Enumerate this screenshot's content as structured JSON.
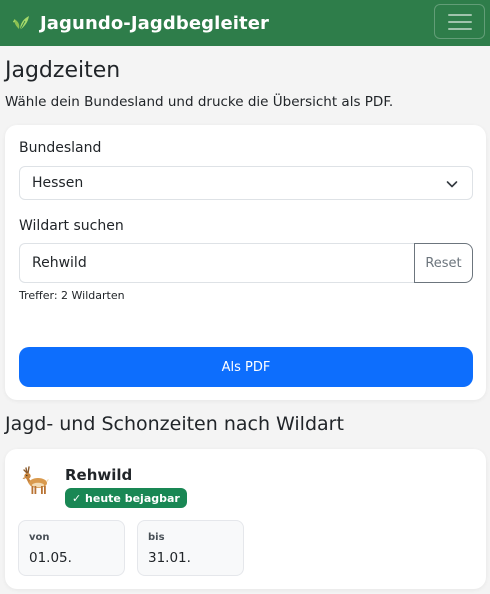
{
  "navbar": {
    "brand": "Jagundo-Jagdbegleiter",
    "brand_icon": "leaf-icon",
    "menu_icon": "hamburger-menu-icon",
    "color": "#2e7d4a"
  },
  "page": {
    "title": "Jagdzeiten",
    "subtitle": "Wähle dein Bundesland und drucke die Übersicht als PDF."
  },
  "filters": {
    "state_label": "Bundesland",
    "state_value": "Hessen",
    "search_label": "Wildart suchen",
    "search_value": "Rehwild",
    "reset_label": "Reset",
    "hits": "Treffer: 2 Wildarten",
    "pdf_label": "Als PDF",
    "pdf_color": "#0d6efd"
  },
  "results": {
    "section_title": "Jagd- und Schonzeiten nach Wildart",
    "items": [
      {
        "icon": "deer-icon",
        "name": "Rehwild",
        "badge": "✓ heute bejagbar",
        "badge_color": "#198754",
        "from_label": "von",
        "from_value": "01.05.",
        "to_label": "bis",
        "to_value": "31.01."
      }
    ]
  }
}
